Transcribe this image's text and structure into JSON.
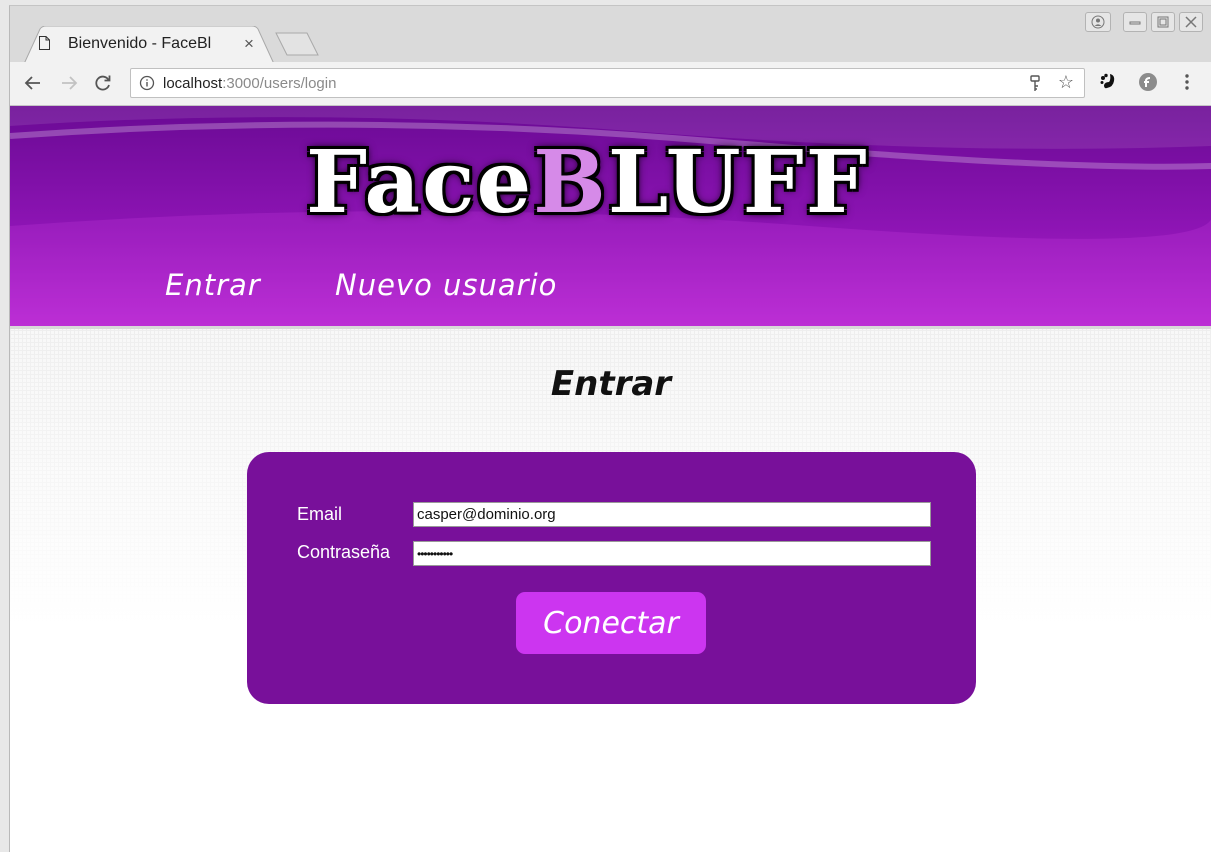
{
  "browser": {
    "tab_title": "Bienvenido - FaceBl",
    "tab_close": "×",
    "url_host": "localhost",
    "url_rest": ":3000/users/login"
  },
  "site": {
    "logo_part1": "Face",
    "logo_part2": "B",
    "logo_part3": "LUFF",
    "nav": [
      "Entrar",
      "Nuevo usuario"
    ]
  },
  "login": {
    "title": "Entrar",
    "email_label": "Email",
    "email_value": "casper@dominio.org",
    "password_label": "Contraseña",
    "password_value": "•••••••••••",
    "submit_label": "Conectar"
  },
  "colors": {
    "header_purple": "#8d14b4",
    "box_purple": "#78109a",
    "button_purple": "#cc35f0"
  }
}
